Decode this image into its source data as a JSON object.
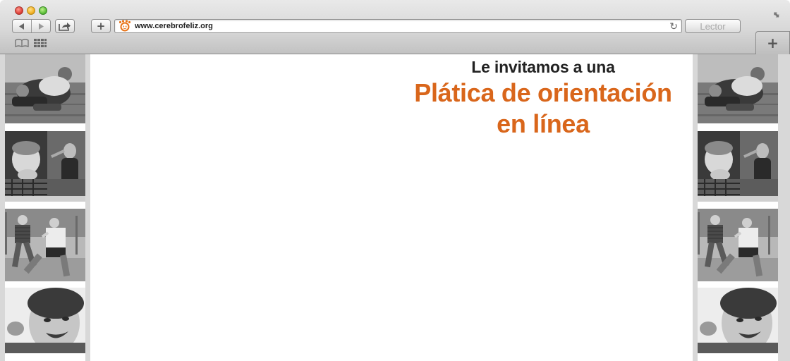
{
  "browser": {
    "url": "www.cerebrofeliz.org",
    "reader_label": "Lector",
    "new_tab_symbol": "+",
    "reload_symbol": "↻",
    "icons": [
      "back-icon",
      "forward-icon",
      "share-icon",
      "add-bookmark-icon",
      "favicon-icon",
      "reload-icon",
      "bookmarks-book-icon",
      "top-sites-grid-icon",
      "resize-icon",
      "new-tab-icon"
    ],
    "colors": {
      "favicon": "#e8751a"
    }
  },
  "page": {
    "invite_text": "Le invitamos a una",
    "title_line1": "Plática de orientación",
    "title_line2": "en línea",
    "colors": {
      "title": "#d9661b",
      "invite": "#222222"
    },
    "side_photos": [
      "children-wrestling-on-grass-photo",
      "boy-resting-chin-teacher-behind-photo",
      "boys-playing-soccer-photo",
      "boy-laughing-closeup-photo"
    ]
  }
}
